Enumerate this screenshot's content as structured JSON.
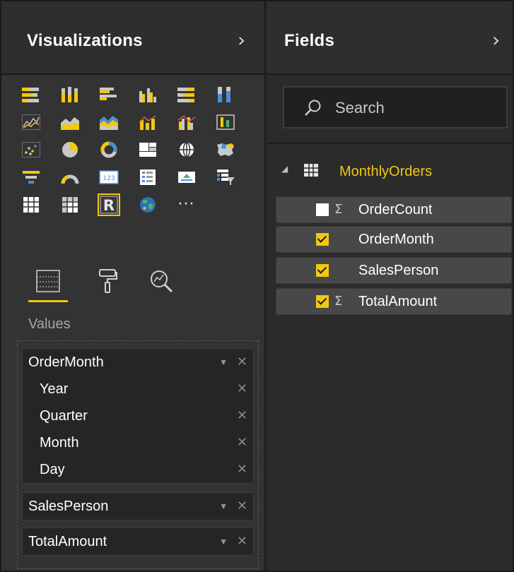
{
  "visualizations": {
    "title": "Visualizations",
    "expand_glyph": "›",
    "icons": [
      "stacked-bar-chart-icon",
      "stacked-column-chart-icon",
      "clustered-bar-chart-icon",
      "clustered-column-chart-icon",
      "100-percent-stacked-bar-icon",
      "100-percent-stacked-column-icon",
      "line-chart-icon",
      "area-chart-icon",
      "stacked-area-chart-icon",
      "line-and-stacked-column-icon",
      "line-and-clustered-column-icon",
      "ribbon-chart-icon",
      "scatter-chart-icon",
      "pie-chart-icon",
      "donut-chart-icon",
      "treemap-icon",
      "map-icon",
      "filled-map-icon",
      "funnel-icon",
      "gauge-icon",
      "card-icon",
      "multi-row-card-icon",
      "kpi-icon",
      "slicer-icon",
      "table-icon",
      "matrix-icon",
      "r-script-visual-icon",
      "globe-map-icon",
      "more-visuals-icon"
    ],
    "card_text": "123",
    "r_text": "R",
    "more_text": "···",
    "tabs": [
      "fields-tab",
      "format-tab",
      "analytics-tab"
    ],
    "values_label": "Values",
    "wells": [
      {
        "name": "OrderMonth",
        "children": [
          "Year",
          "Quarter",
          "Month",
          "Day"
        ]
      },
      {
        "name": "SalesPerson"
      },
      {
        "name": "TotalAmount"
      }
    ],
    "dropdown_glyph": "▼",
    "remove_glyph": "✕"
  },
  "fields_pane": {
    "title": "Fields",
    "expand_glyph": "›",
    "search_placeholder": "Search",
    "table_name": "MonthlyOrders",
    "collapse_glyph": "◢",
    "sigma": "Σ",
    "fields": [
      {
        "name": "OrderCount",
        "checked": false,
        "sigma": true
      },
      {
        "name": "OrderMonth",
        "checked": true,
        "sigma": false
      },
      {
        "name": "SalesPerson",
        "checked": true,
        "sigma": false
      },
      {
        "name": "TotalAmount",
        "checked": true,
        "sigma": true
      }
    ]
  },
  "colors": {
    "accent": "#f2c811",
    "pane_bg": "#333333",
    "header_bg": "#2e2e2e",
    "field_bg": "#484848"
  }
}
